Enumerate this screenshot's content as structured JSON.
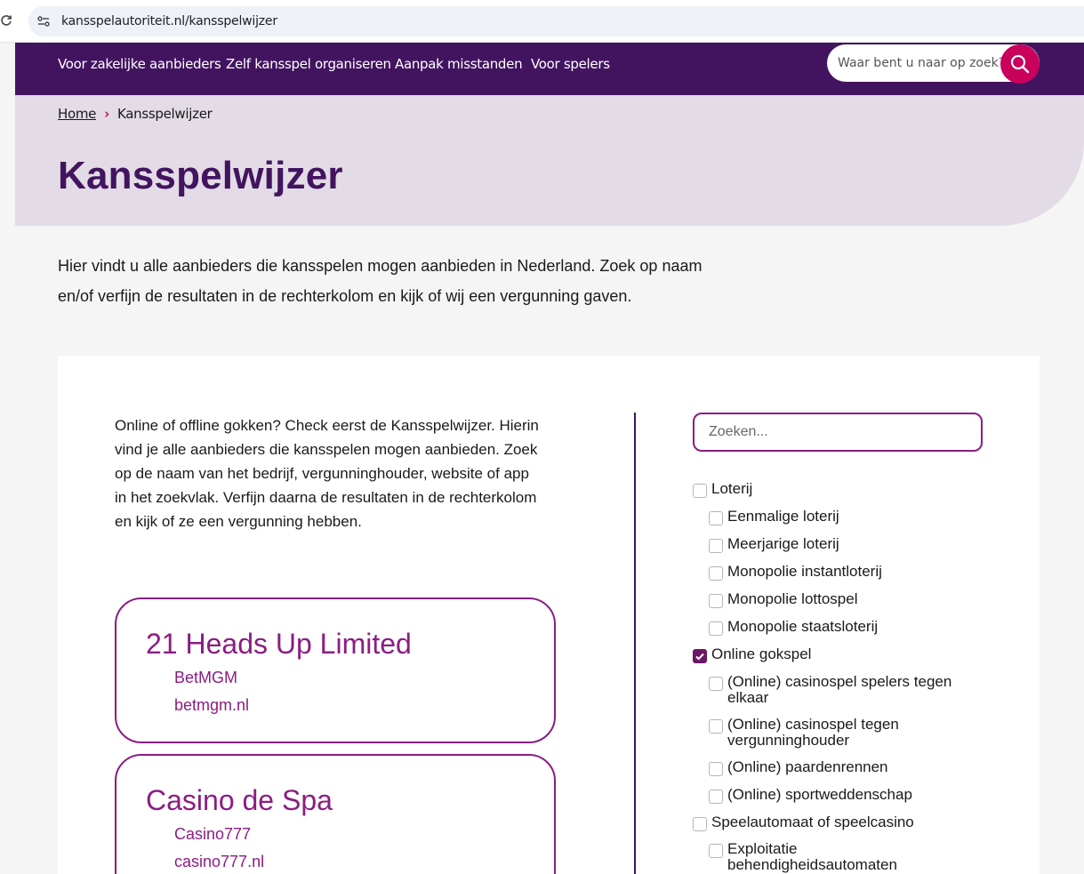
{
  "browser": {
    "url": "kansspelautoriteit.nl/kansspelwijzer"
  },
  "nav": {
    "items": [
      "Voor zakelijke aanbieders",
      "Zelf kansspel organiseren",
      "Aanpak misstanden",
      "Voor spelers"
    ],
    "search_placeholder": "Waar bent u naar op zoek?"
  },
  "breadcrumb": {
    "home": "Home",
    "current": "Kansspelwijzer"
  },
  "page": {
    "title": "Kansspelwijzer",
    "intro": "Hier vindt u alle aanbieders die kansspelen mogen aanbieden in Nederland. Zoek op naam en/of verfijn de resultaten in de rechterkolom en kijk of wij een vergunning gaven."
  },
  "card": {
    "text": "Online of offline gokken? Check eerst de Kansspelwijzer. Hierin vind je alle aanbieders die kansspelen mogen aanbieden. Zoek op de naam van het bedrijf, vergunninghouder, website of app in het zoekvlak. Verfijn daarna de resultaten in de rechterkolom en kijk of ze een vergunning hebben."
  },
  "results": [
    {
      "name": "21 Heads Up Limited",
      "brand": "BetMGM",
      "site": "betmgm.nl"
    },
    {
      "name": "Casino de Spa",
      "brand": "Casino777",
      "site": "casino777.nl"
    }
  ],
  "filter": {
    "search_placeholder": "Zoeken...",
    "options": [
      {
        "label": "Loterij",
        "checked": false
      },
      {
        "label": "Eenmalige loterij",
        "checked": false
      },
      {
        "label": "Meerjarige loterij",
        "checked": false
      },
      {
        "label": "Monopolie instantloterij",
        "checked": false
      },
      {
        "label": "Monopolie lottospel",
        "checked": false
      },
      {
        "label": "Monopolie staatsloterij",
        "checked": false
      },
      {
        "label": "Online gokspel",
        "checked": true
      },
      {
        "label": "(Online) casinospel spelers tegen elkaar",
        "checked": false
      },
      {
        "label": "(Online) casinospel tegen vergunninghouder",
        "checked": false
      },
      {
        "label": "(Online) paardenrennen",
        "checked": false
      },
      {
        "label": "(Online) sportweddenschap",
        "checked": false
      },
      {
        "label": "Speelautomaat of speelcasino",
        "checked": false
      },
      {
        "label": "Exploitatie behendigheidsautomaten",
        "checked": false
      }
    ]
  },
  "colors": {
    "brand_purple": "#42145f",
    "accent_pink": "#ca005d",
    "result_purple": "#8b1d82",
    "hero_bg": "#e3dbe6"
  },
  "icons": {
    "reload": "reload-icon",
    "site_info": "site-info-icon",
    "search": "search-icon",
    "breadcrumb_sep": "chevron-right-icon",
    "check": "check-icon"
  }
}
